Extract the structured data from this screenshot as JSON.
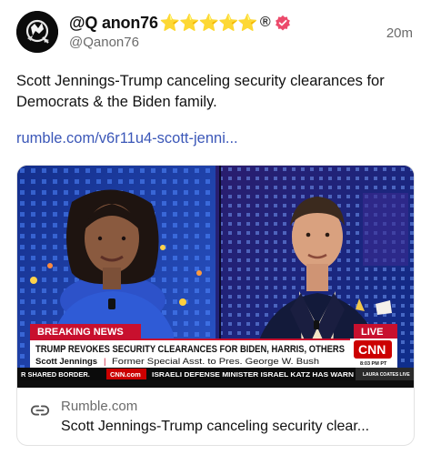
{
  "post": {
    "display_name": "@Q anon76",
    "stars": "⭐⭐⭐⭐⭐",
    "registered_mark": "®",
    "handle": "@Qanon76",
    "time": "20m",
    "text": "Scott Jennings-Trump canceling security clearances for Democrats & the Biden family.",
    "link": "rumble.com/v6r11u4-scott-jenni..."
  },
  "card": {
    "domain": "Rumble.com",
    "title": "Scott Jennings-Trump canceling security clear...",
    "thumbnail": {
      "breaking_label": "BREAKING NEWS",
      "live_label": "LIVE",
      "headline": "TRUMP REVOKES SECURITY CLEARANCES FOR BIDEN, HARRIS, OTHERS",
      "subtitle_name": "Scott Jennings",
      "subtitle_role": "Former Special Asst. to Pres. George W. Bush",
      "network": "CNN",
      "time": "8:03 PM PT",
      "ticker_left": "R SHARED BORDER.",
      "ticker_site": "CNN.com",
      "ticker_right": "ISRAELI DEFENSE MINISTER ISRAEL KATZ HAS WARN",
      "show_badge": "LAURA COATES LIVE"
    }
  },
  "colors": {
    "link": "#3b57b8",
    "verified_badge": "#ec4a6b",
    "breaking_red": "#c8102e",
    "cnn_red": "#cc0000"
  },
  "icons": {
    "avatar": "q-anon-avatar",
    "verified": "verified-badge-icon",
    "link": "link-chain-icon"
  }
}
